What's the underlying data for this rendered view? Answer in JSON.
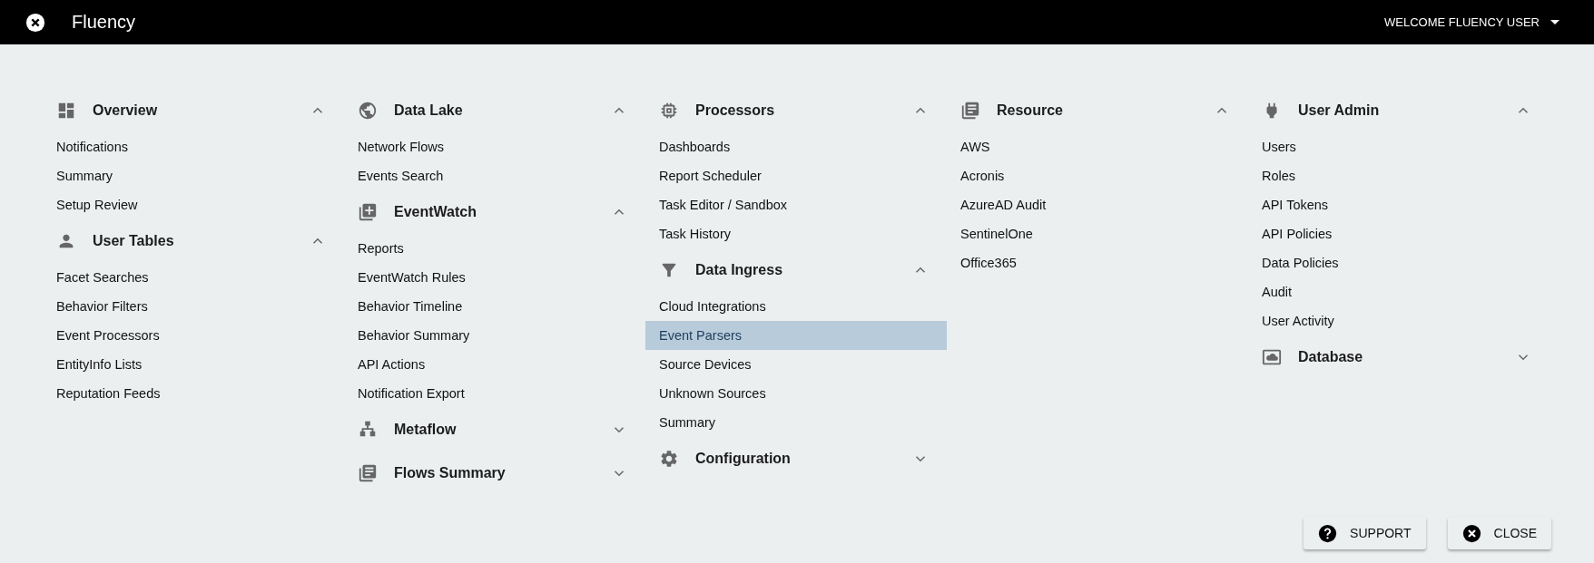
{
  "app_bar": {
    "title": "Fluency",
    "user_menu": "WELCOME FLUENCY USER"
  },
  "columns": [
    [
      {
        "title": "Overview",
        "kind": "dashboard",
        "expanded": true,
        "items": [
          {
            "label": "Notifications",
            "selected": false
          },
          {
            "label": "Summary",
            "selected": false
          },
          {
            "label": "Setup Review",
            "selected": false
          }
        ]
      },
      {
        "title": "User Tables",
        "kind": "person",
        "expanded": true,
        "items": [
          {
            "label": "Facet Searches",
            "selected": false
          },
          {
            "label": "Behavior Filters",
            "selected": false
          },
          {
            "label": "Event Processors",
            "selected": false
          },
          {
            "label": "EntityInfo Lists",
            "selected": false
          },
          {
            "label": "Reputation Feeds",
            "selected": false
          }
        ]
      }
    ],
    [
      {
        "title": "Data Lake",
        "kind": "globe",
        "expanded": true,
        "items": [
          {
            "label": "Network Flows",
            "selected": false
          },
          {
            "label": "Events Search",
            "selected": false
          }
        ]
      },
      {
        "title": "EventWatch",
        "kind": "libraryadd",
        "expanded": true,
        "items": [
          {
            "label": "Reports",
            "selected": false
          },
          {
            "label": "EventWatch Rules",
            "selected": false
          },
          {
            "label": "Behavior Timeline",
            "selected": false
          },
          {
            "label": "Behavior Summary",
            "selected": false
          },
          {
            "label": "API Actions",
            "selected": false
          },
          {
            "label": "Notification Export",
            "selected": false
          }
        ]
      },
      {
        "title": "Metaflow",
        "kind": "sitemap",
        "expanded": false
      },
      {
        "title": "Flows Summary",
        "kind": "list",
        "expanded": false
      }
    ],
    [
      {
        "title": "Processors",
        "kind": "chip",
        "expanded": true,
        "items": [
          {
            "label": "Dashboards",
            "selected": false
          },
          {
            "label": "Report Scheduler",
            "selected": false
          },
          {
            "label": "Task Editor / Sandbox",
            "selected": false
          },
          {
            "label": "Task History",
            "selected": false
          }
        ]
      },
      {
        "title": "Data Ingress",
        "kind": "filter",
        "expanded": true,
        "items": [
          {
            "label": "Cloud Integrations",
            "selected": false
          },
          {
            "label": "Event Parsers",
            "selected": true
          },
          {
            "label": "Source Devices",
            "selected": false
          },
          {
            "label": "Unknown Sources",
            "selected": false
          },
          {
            "label": "Summary",
            "selected": false
          }
        ]
      },
      {
        "title": "Configuration",
        "kind": "gear",
        "expanded": false
      }
    ],
    [
      {
        "title": "Resource",
        "kind": "list",
        "expanded": true,
        "items": [
          {
            "label": "AWS",
            "selected": false
          },
          {
            "label": "Acronis",
            "selected": false
          },
          {
            "label": "AzureAD Audit",
            "selected": false
          },
          {
            "label": "SentinelOne",
            "selected": false
          },
          {
            "label": "Office365",
            "selected": false
          }
        ]
      }
    ],
    [
      {
        "title": "User Admin",
        "kind": "plug",
        "expanded": true,
        "items": [
          {
            "label": "Users",
            "selected": false
          },
          {
            "label": "Roles",
            "selected": false
          },
          {
            "label": "API Tokens",
            "selected": false
          },
          {
            "label": "API Policies",
            "selected": false
          },
          {
            "label": "Data Policies",
            "selected": false
          },
          {
            "label": "Audit",
            "selected": false
          },
          {
            "label": "User Activity",
            "selected": false
          }
        ]
      },
      {
        "title": "Database",
        "kind": "cloud",
        "expanded": false
      }
    ]
  ],
  "buttons": [
    {
      "label": "SUPPORT",
      "kind": "help"
    },
    {
      "label": "CLOSE",
      "kind": "close"
    }
  ]
}
